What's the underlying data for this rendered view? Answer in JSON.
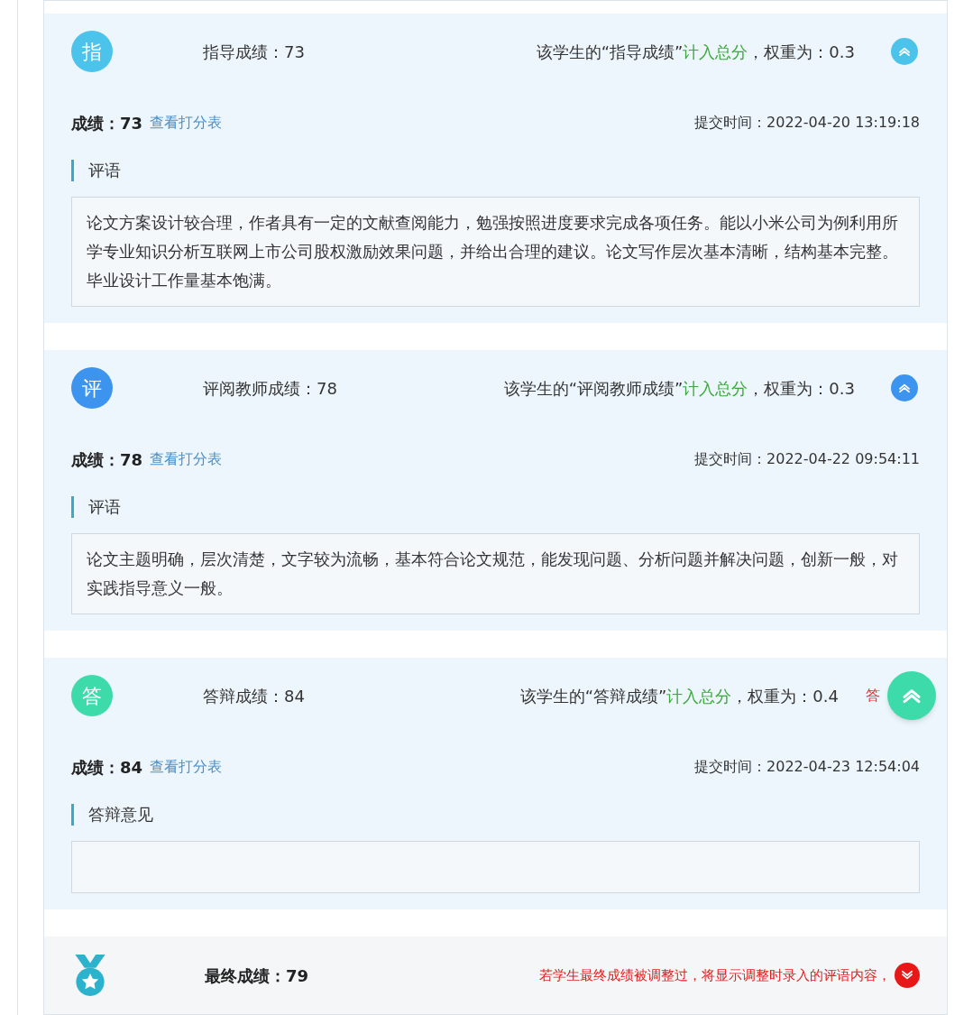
{
  "sections": [
    {
      "badge": "指",
      "color": "#4cc3ea",
      "title": "指导成绩：73",
      "weight_prefix": "该学生的“指导成绩”",
      "weight_status": "计入总分",
      "weight_suffix": "，权重为：0.3",
      "floating": false,
      "expanded": true,
      "score": "成绩：73",
      "link": "查看打分表",
      "submit_time": "提交时间：2022-04-20 13:19:18",
      "comment_label": "评语",
      "comment": "论文方案设计较合理，作者具有一定的文献查阅能力，勉强按照进度要求完成各项任务。能以小米公司为例利用所学专业知识分析互联网上市公司股权激励效果问题，并给出合理的建议。论文写作层次基本清晰，结构基本完整。毕业设计工作量基本饱满。"
    },
    {
      "badge": "评",
      "color": "#3d94ef",
      "title": "评阅教师成绩：78",
      "weight_prefix": "该学生的“评阅教师成绩”",
      "weight_status": "计入总分",
      "weight_suffix": "，权重为：0.3",
      "floating": false,
      "expanded": true,
      "score": "成绩：78",
      "link": "查看打分表",
      "submit_time": "提交时间：2022-04-22 09:54:11",
      "comment_label": "评语",
      "comment": "论文主题明确，层次清楚，文字较为流畅，基本符合论文规范，能发现问题、分析问题并解决问题，创新一般，对实践指导意义一般。"
    },
    {
      "badge": "答",
      "color": "#3ddbaa",
      "title": "答辩成绩：84",
      "weight_prefix": "该学生的“答辩成绩”",
      "weight_status": "计入总分",
      "weight_suffix": "，权重为：0.4",
      "note": "答",
      "floating": true,
      "expanded": true,
      "score": "成绩：84",
      "link": "查看打分表",
      "submit_time": "提交时间：2022-04-23 12:54:04",
      "comment_label": "答辩意见"
    }
  ],
  "final": {
    "title": "最终成绩：79",
    "note": "若学生最终成绩被调整过，将显示调整时录入的评语内容，",
    "expanded": false
  }
}
